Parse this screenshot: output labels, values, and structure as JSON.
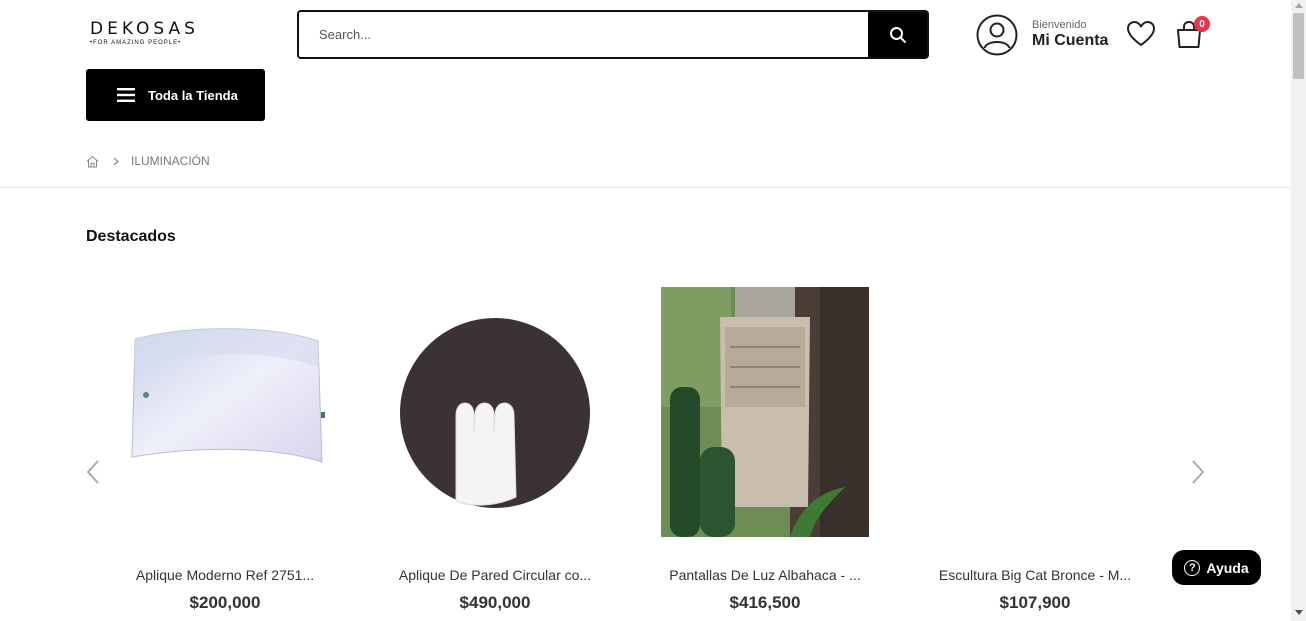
{
  "header": {
    "logo_main": "DEKOSAS",
    "logo_tagline": "•FOR AMAZING PEOPLE•",
    "search_placeholder": "Search...",
    "account_greeting": "Bienvenido",
    "account_label": "Mi Cuenta",
    "cart_count": "0"
  },
  "nav": {
    "store_button_label": "Toda la Tienda"
  },
  "breadcrumb": {
    "current": "ILUMINACIÓN"
  },
  "section": {
    "title": "Destacados"
  },
  "products": [
    {
      "name": "Aplique Moderno Ref 2751...",
      "price": "$200,000"
    },
    {
      "name": "Aplique De Pared Circular co...",
      "price": "$490,000"
    },
    {
      "name": "Pantallas De Luz Albahaca - ...",
      "price": "$416,500"
    },
    {
      "name": "Escultura Big Cat Bronce - M...",
      "price": "$107,900"
    }
  ],
  "help": {
    "label": "Ayuda"
  },
  "colors": {
    "accent": "#000000",
    "badge": "#e8334f"
  }
}
